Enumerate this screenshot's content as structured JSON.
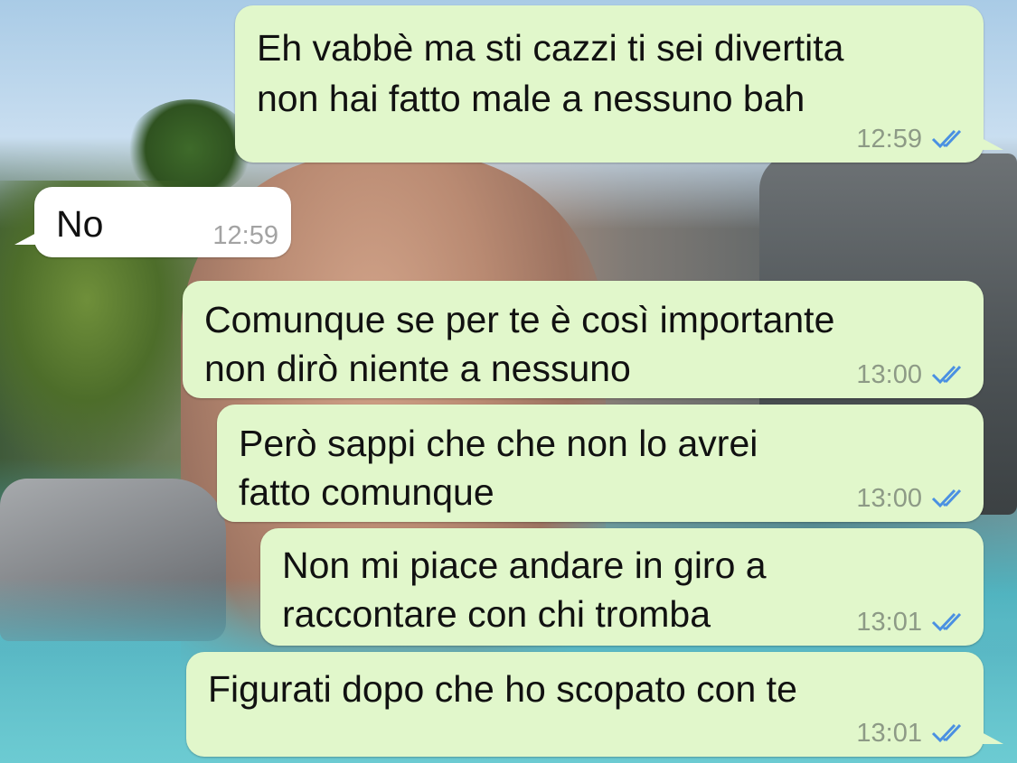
{
  "messages": [
    {
      "direction": "outgoing",
      "lines": [
        "Eh vabbè ma sti cazzi ti sei divertita",
        "non hai fatto male a nessuno bah"
      ],
      "time": "12:59",
      "status": "read",
      "status_icon": "double-check-icon"
    },
    {
      "direction": "incoming",
      "lines": [
        "No"
      ],
      "time": "12:59"
    },
    {
      "direction": "outgoing",
      "lines": [
        "Comunque se per te è così importante",
        "non dirò niente a nessuno"
      ],
      "time": "13:00",
      "status": "read",
      "status_icon": "double-check-icon"
    },
    {
      "direction": "outgoing",
      "lines": [
        "Però sappi che che non lo avrei",
        "fatto comunque"
      ],
      "time": "13:00",
      "status": "read",
      "status_icon": "double-check-icon"
    },
    {
      "direction": "outgoing",
      "lines": [
        "Non mi piace andare in giro a",
        "raccontare con chi tromba"
      ],
      "time": "13:01",
      "status": "read",
      "status_icon": "double-check-icon"
    },
    {
      "direction": "outgoing",
      "lines": [
        "Figurati dopo che ho scopato con te"
      ],
      "time": "13:01",
      "status": "read",
      "status_icon": "double-check-icon"
    }
  ],
  "colors": {
    "outgoing_bubble": "#e1f7cb",
    "incoming_bubble": "#ffffff",
    "read_ticks": "#4a90e2",
    "timestamp": "#8d9a86"
  }
}
